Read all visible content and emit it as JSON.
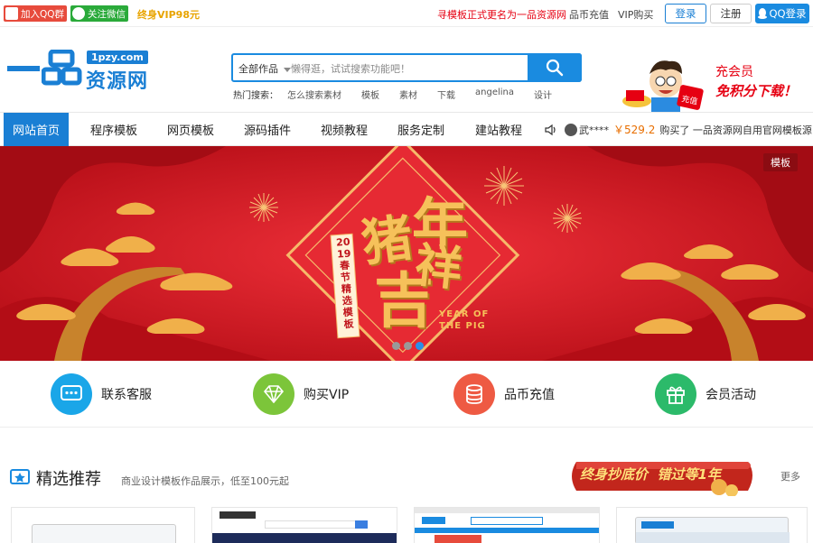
{
  "topbar": {
    "qq_group": "加入QQ群",
    "wechat": "关注微信",
    "vip": "终身VIP98元",
    "notice": "寻模板正式更名为一品资源网",
    "coin": "品币充值",
    "vip_buy": "VIP购买",
    "login": "登录",
    "register": "注册",
    "qq_login": "QQ登录"
  },
  "logo": {
    "url": "1pzy.com",
    "name": "资源网"
  },
  "search": {
    "category": "全部作品",
    "placeholder": "懒得逛，试试搜索功能吧！",
    "hot_label": "热门搜索：",
    "hot": [
      "怎么搜索素材",
      "模板",
      "素材",
      "下载",
      "angelina",
      "设计"
    ]
  },
  "promo": {
    "line1": "充会员",
    "line2": "免积分下载！",
    "badge": "充值"
  },
  "nav": {
    "items": [
      "网站首页",
      "程序模板",
      "网页模板",
      "源码插件",
      "视频教程",
      "服务定制",
      "建站教程"
    ],
    "ticker_user": "武****",
    "ticker_price": "￥529.2",
    "ticker_text": "购买了 一品资源网自用官网模板源"
  },
  "banner": {
    "tag": "模板",
    "vertical": "2019春节精选模板",
    "big1": "猪",
    "big2": "年",
    "big3": "吉",
    "big4": "祥",
    "english": "YEAR OF THE PIG"
  },
  "services": [
    "联系客服",
    "购买VIP",
    "品币充值",
    "会员活动"
  ],
  "section": {
    "title": "精选推荐",
    "subtitle": "商业设计模板作品展示，低至100元起",
    "promo": "终身抄底价  错过等1年",
    "more": "更多"
  },
  "colors": {
    "brand": "#1a7fd4",
    "banner": "#d91a23",
    "gold": "#f0b04a"
  }
}
